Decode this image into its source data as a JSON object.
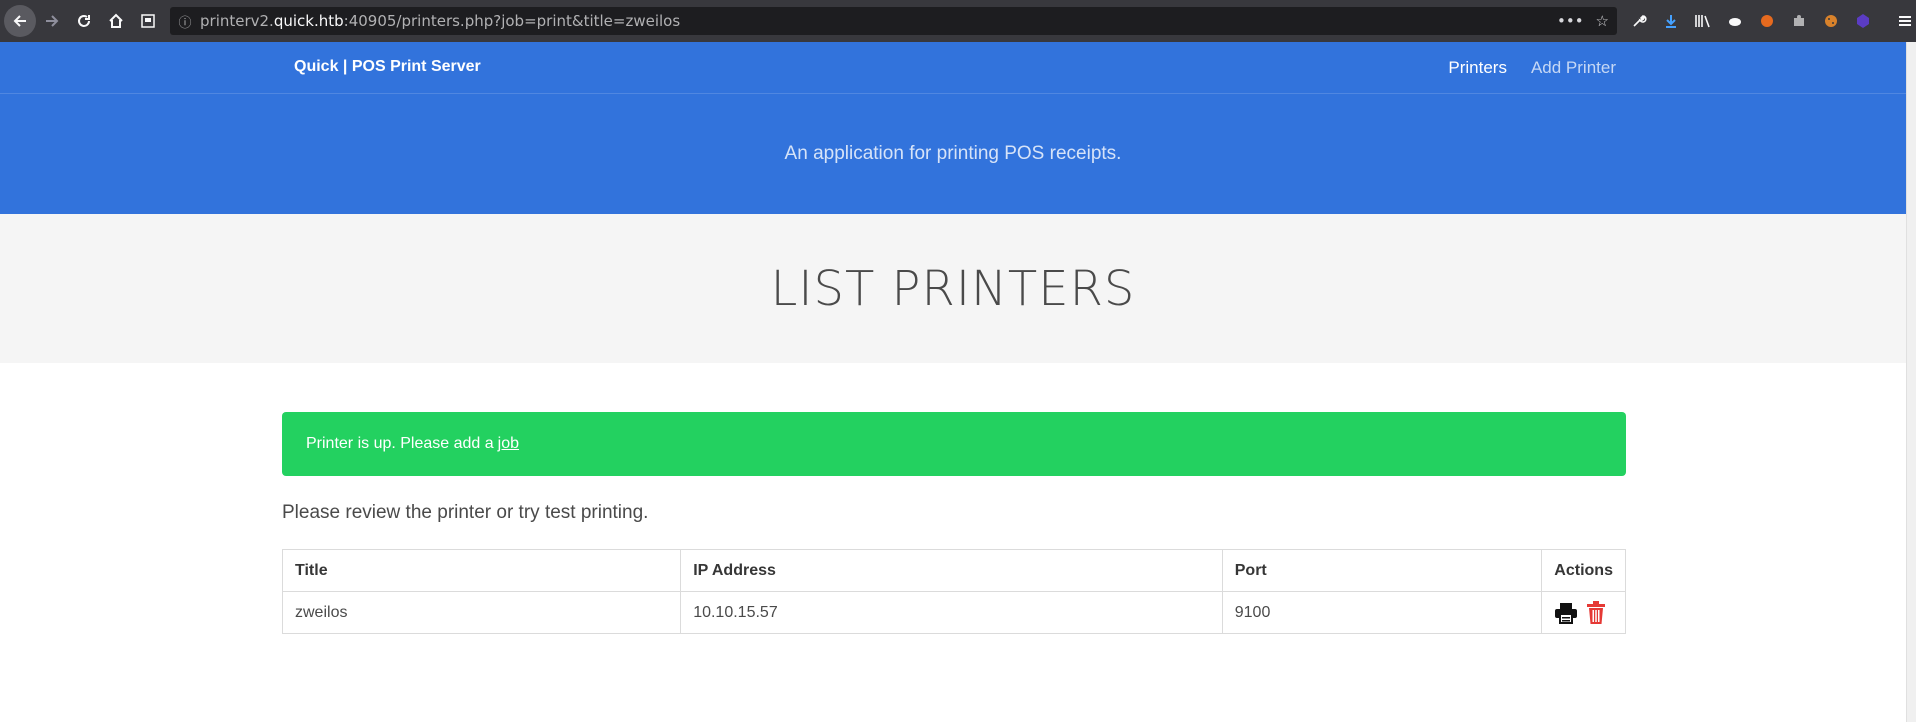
{
  "browser": {
    "url_prefix": "printerv2.",
    "url_domain": "quick.htb",
    "url_suffix": ":40905/printers.php?job=print&title=zweilos",
    "more_label": "•••"
  },
  "navbar": {
    "brand": "Quick | POS Print Server",
    "links": [
      {
        "label": "Printers"
      },
      {
        "label": "Add Printer"
      }
    ]
  },
  "hero": {
    "tagline": "An application for printing POS receipts."
  },
  "page": {
    "title": "LIST PRINTERS",
    "alert_text": "Printer is up. Please add a",
    "alert_link": "job",
    "subtitle": "Please review the printer or try test printing."
  },
  "table": {
    "headers": [
      "Title",
      "IP Address",
      "Port",
      "Actions"
    ],
    "rows": [
      {
        "title": "zweilos",
        "ip": "10.10.15.57",
        "port": "9100"
      }
    ]
  },
  "colors": {
    "primary": "#3273dc",
    "success": "#23d160",
    "danger": "#e53935"
  }
}
